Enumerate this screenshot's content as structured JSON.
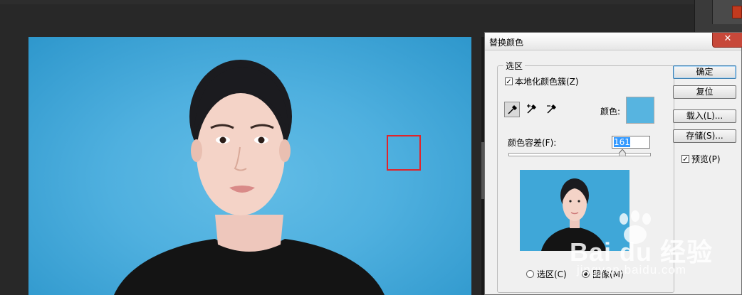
{
  "dialog": {
    "title": "替换颜色",
    "close_label": "✕",
    "selection_group": "选区",
    "localized_clusters_label": "本地化颜色簇(Z)",
    "localized_clusters_checked": true,
    "color_label": "颜色:",
    "selected_color": "#57b4e0",
    "fuzziness_label": "颜色容差(F):",
    "fuzziness_value": "161",
    "fuzziness_fraction": 0.81,
    "radio_selection": "选区(C)",
    "radio_image": "图像(M)",
    "radio_selected": "image",
    "buttons": {
      "ok": "确定",
      "reset": "复位",
      "load": "载入(L)...",
      "save": "存储(S)..."
    },
    "preview_label": "预览(P)",
    "preview_checked": true
  },
  "tools": [
    "eyedropper-icon",
    "eyedropper-plus-icon",
    "eyedropper-minus-icon"
  ],
  "canvas": {
    "background_color": "#4fb0df",
    "sample_marker_color": "#e0242a"
  },
  "watermark": {
    "main": "Bai du 经验",
    "sub": "jingyan.baidu.com"
  }
}
